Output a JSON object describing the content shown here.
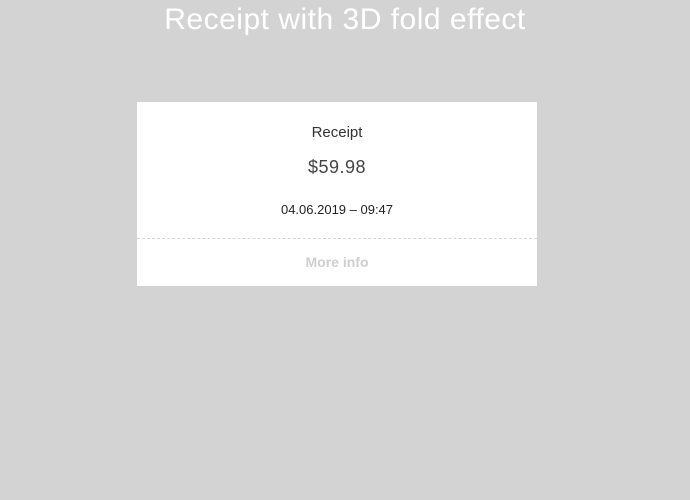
{
  "page": {
    "title": "Receipt with 3D fold effect"
  },
  "receipt": {
    "label": "Receipt",
    "amount": "$59.98",
    "datetime": "04.06.2019 – 09:47",
    "more_info_label": "More info"
  }
}
